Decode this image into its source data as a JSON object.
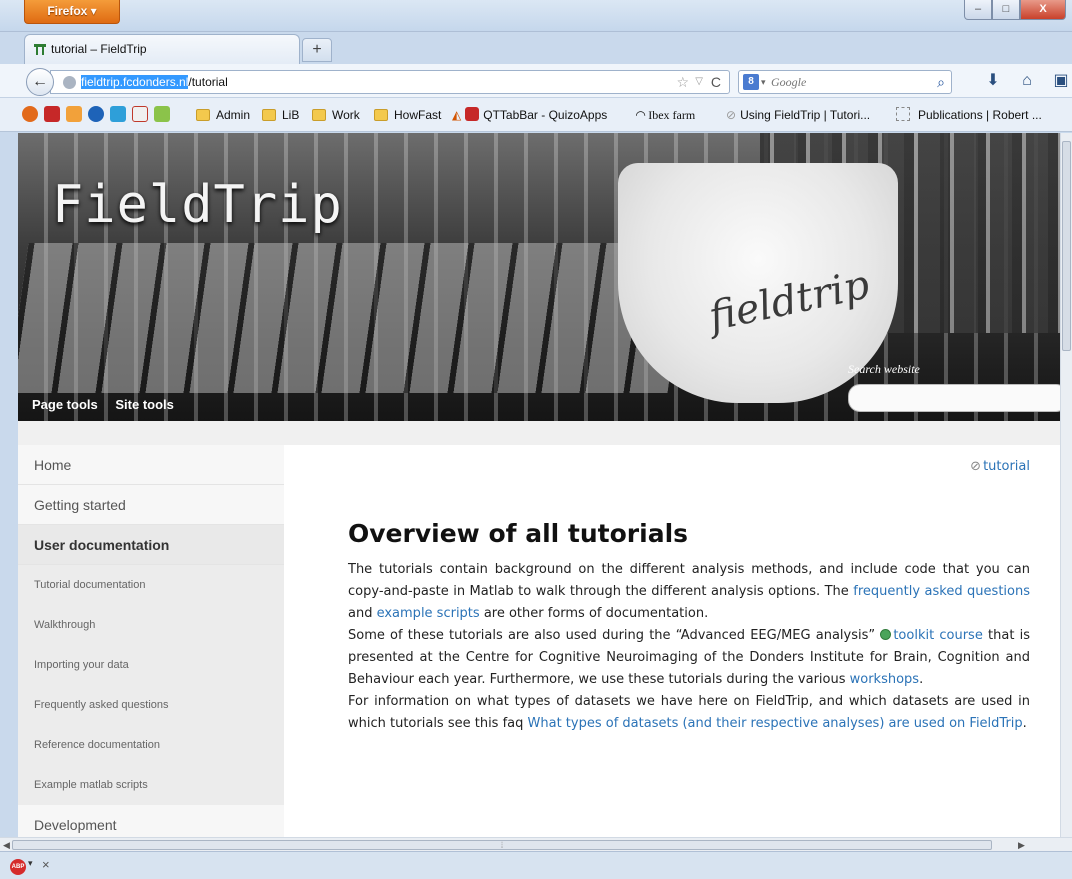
{
  "browser": {
    "menu_button": "Firefox ▾",
    "window_controls": [
      "–",
      "□",
      "X"
    ]
  },
  "tab": {
    "title": "tutorial – FieldTrip",
    "new_tab_label": "+"
  },
  "nav": {
    "url_host": "fieldtrip.fcdonders.nl",
    "url_path": "/tutorial",
    "search_engine_icon": "8",
    "search_placeholder": "Google"
  },
  "bookmarks": [
    "Admin",
    "LiB",
    "Work",
    "HowFast",
    "QTTabBar - QuizoApps",
    "Ibex farm",
    "Using FieldTrip | Tutori...",
    "Publications | Robert ..."
  ],
  "header": {
    "logo": "FieldTrip",
    "cup_script": "fieldtrip",
    "menu": [
      "Page tools",
      "Site tools"
    ],
    "search_label": "Search website"
  },
  "sidebar": {
    "items": [
      {
        "label": "Home",
        "type": "top"
      },
      {
        "label": "Getting started",
        "type": "top"
      },
      {
        "label": "User documentation",
        "type": "active"
      },
      {
        "label": "Tutorial documentation",
        "type": "sub"
      },
      {
        "label": "Walkthrough",
        "type": "sub"
      },
      {
        "label": "Importing your data",
        "type": "sub"
      },
      {
        "label": "Frequently asked questions",
        "type": "sub"
      },
      {
        "label": "Reference documentation",
        "type": "sub"
      },
      {
        "label": "Example matlab scripts",
        "type": "sub"
      },
      {
        "label": "Development",
        "type": "top"
      }
    ]
  },
  "content": {
    "tag": "tutorial",
    "heading": "Overview of all tutorials",
    "p1_a": "The tutorials contain background on the different analysis methods, and include code that you can copy-and-paste in Matlab to walk through the different analysis options. The ",
    "p1_link1": "frequently asked questions",
    "p1_b": " and ",
    "p1_link2": "example scripts",
    "p1_c": " are other forms of documentation.",
    "p2_a": "Some of these tutorials are also used during the “Advanced EEG/MEG analysis” ",
    "p2_link1": "toolkit course",
    "p2_b": " that is presented at the Centre for Cognitive Neuroimaging of the Donders Institute for Brain, Cognition and Behaviour each year. Furthermore, we use these tutorials during the various ",
    "p2_link2": "workshops",
    "p2_c": ".",
    "p3_a": "For information on what types of datasets we have here on FieldTrip, and which datasets are used in which tutorials see this faq ",
    "p3_link": "What types of datasets (and their respective analyses) are used on FieldTrip",
    "p3_b": "."
  },
  "status": {
    "addon_label": "ABP",
    "close_label": "×"
  }
}
